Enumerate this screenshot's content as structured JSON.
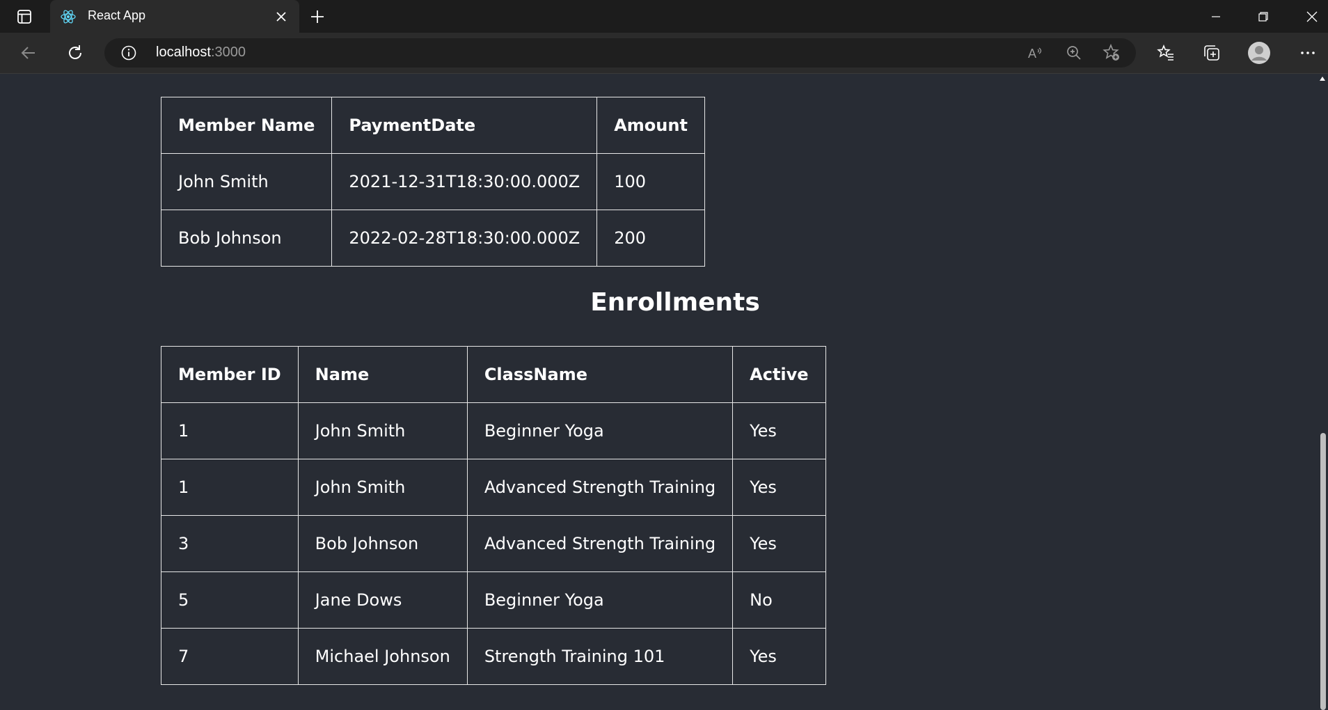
{
  "browser": {
    "tab": {
      "title": "React App",
      "favicon": "react-logo-icon"
    },
    "address": {
      "host": "localhost",
      "port": ":3000"
    },
    "read_aloud_label": "A¹",
    "colors": {
      "tabstrip": "#1c1c1c",
      "toolbar": "#2b2b2b",
      "page_bg": "#282c34"
    }
  },
  "payments": {
    "headers": [
      "Member Name",
      "PaymentDate",
      "Amount"
    ],
    "rows": [
      [
        "John Smith",
        "2021-12-31T18:30:00.000Z",
        "100"
      ],
      [
        "Bob Johnson",
        "2022-02-28T18:30:00.000Z",
        "200"
      ]
    ]
  },
  "enrollments": {
    "title": "Enrollments",
    "headers": [
      "Member ID",
      "Name",
      "ClassName",
      "Active"
    ],
    "rows": [
      [
        "1",
        "John Smith",
        "Beginner Yoga",
        "Yes"
      ],
      [
        "1",
        "John Smith",
        "Advanced Strength Training",
        "Yes"
      ],
      [
        "3",
        "Bob Johnson",
        "Advanced Strength Training",
        "Yes"
      ],
      [
        "5",
        "Jane Dows",
        "Beginner Yoga",
        "No"
      ],
      [
        "7",
        "Michael Johnson",
        "Strength Training 101",
        "Yes"
      ]
    ]
  }
}
